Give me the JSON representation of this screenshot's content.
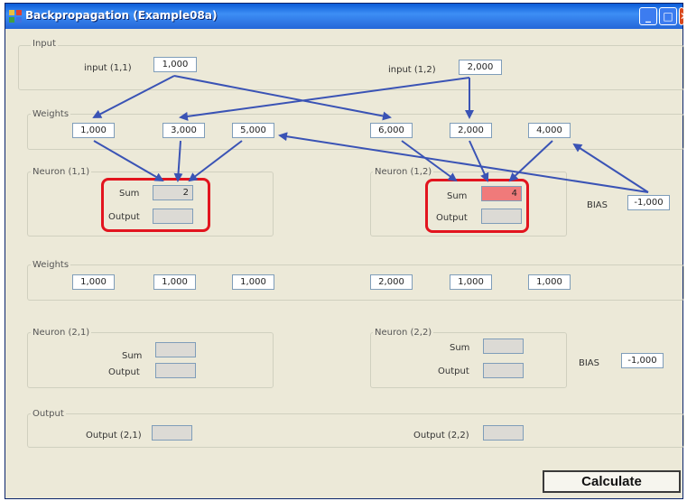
{
  "window": {
    "title": "Backpropagation (Example08a)"
  },
  "input": {
    "group_label": "Input",
    "in1_label": "input (1,1)",
    "in1_value": "1,000",
    "in2_label": "input (1,2)",
    "in2_value": "2,000"
  },
  "weights1": {
    "group_label": "Weights",
    "values": [
      "1,000",
      "3,000",
      "5,000",
      "6,000",
      "2,000",
      "4,000"
    ]
  },
  "neuron11": {
    "label": "Neuron (1,1)",
    "sum_label": "Sum",
    "sum_value": "2",
    "output_label": "Output",
    "output_value": ""
  },
  "neuron12": {
    "label": "Neuron (1,2)",
    "sum_label": "Sum",
    "sum_value": "4",
    "output_label": "Output",
    "output_value": ""
  },
  "bias1": {
    "label": "BIAS",
    "value": "-1,000"
  },
  "weights2": {
    "group_label": "Weights",
    "values": [
      "1,000",
      "1,000",
      "1,000",
      "2,000",
      "1,000",
      "1,000"
    ]
  },
  "neuron21": {
    "label": "Neuron (2,1)",
    "sum_label": "Sum",
    "sum_value": "",
    "output_label": "Output",
    "output_value": ""
  },
  "neuron22": {
    "label": "Neuron (2,2)",
    "sum_label": "Sum",
    "sum_value": "",
    "output_label": "Output",
    "output_value": ""
  },
  "bias2": {
    "label": "BIAS",
    "value": "-1,000"
  },
  "output": {
    "group_label": "Output",
    "out1_label": "Output (2,1)",
    "out1_value": "",
    "out2_label": "Output (2,2)",
    "out2_value": ""
  },
  "calculate_label": "Calculate",
  "colors": {
    "arrow": "#3A53B5",
    "highlight": "#E2141E",
    "sum_highlight": "#F07A7A"
  }
}
